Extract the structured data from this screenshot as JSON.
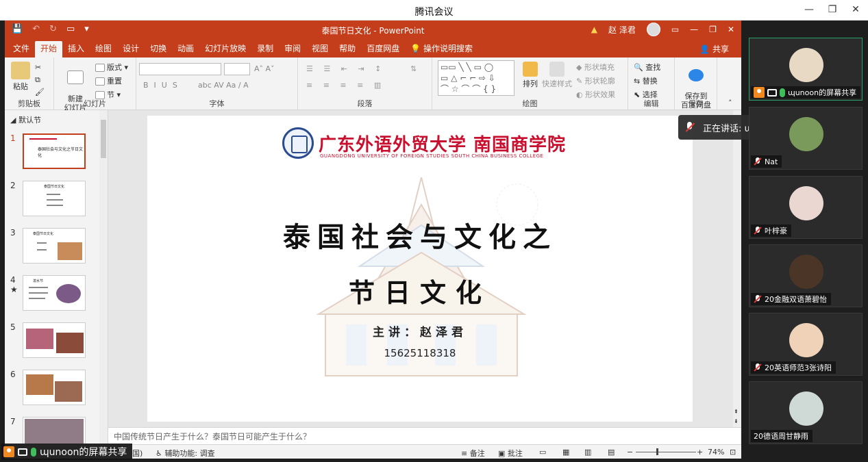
{
  "app": {
    "title": "腾讯会议"
  },
  "ppt": {
    "doc_title": "泰国节日文化 - PowerPoint",
    "user": "赵 泽君",
    "tabs": [
      "文件",
      "开始",
      "插入",
      "绘图",
      "设计",
      "切换",
      "动画",
      "幻灯片放映",
      "录制",
      "审阅",
      "视图",
      "帮助",
      "百度网盘"
    ],
    "active_tab": "开始",
    "tell_me": "操作说明搜索",
    "share": "共享",
    "ribbon": {
      "paste": "粘贴",
      "clipboard": "剪贴板",
      "new_slide": "新建\n幻灯片",
      "layout": "版式",
      "reset": "重置",
      "section": "节",
      "slides": "幻灯片",
      "font": "字体",
      "paragraph": "段落",
      "arrange": "排列",
      "quick_styles": "快速样式",
      "shape_fill": "形状填充",
      "shape_outline": "形状轮廓",
      "shape_effects": "形状效果",
      "drawing": "绘图",
      "find": "查找",
      "replace": "替换",
      "select": "选择",
      "editing": "编辑",
      "save_to_baidu": "保存到\n百度网盘",
      "save": "保存"
    },
    "thumbnails": {
      "section": "默认节",
      "numbers": [
        "1",
        "2",
        "3",
        "4",
        "5",
        "6",
        "7"
      ],
      "titles": [
        "泰国社会与文化之节日文化",
        "泰国节日文化",
        "泰国节日文化",
        "泼水节"
      ]
    },
    "slide": {
      "uni_name_cn": "广东外语外贸大学 南国商学院",
      "uni_name_en": "GUANGDONG UNIVERSITY OF FOREIGN STUDIES   SOUTH CHINA BUSINESS COLLEGE",
      "title_line1": "泰国社会与文化之",
      "title_line2": "节日文化",
      "presenter": "主讲：赵泽君",
      "phone": "15625118318"
    },
    "notes": "中国传统节日产生于什么？泰国节日可能产生于什么？",
    "status": {
      "accessibility": "辅助功能: 调查",
      "notes_btn": "备注",
      "comments_btn": "批注",
      "zoom": "74%",
      "partial_lang": "国)"
    }
  },
  "meeting": {
    "speaking_label": "正在讲话: ɰunoon;",
    "participants": [
      {
        "name": "ɰunoon的屏幕共享",
        "avatar_color": "#e8d9c4"
      },
      {
        "name": "Nat",
        "avatar_color": "#7a9a5b"
      },
      {
        "name": "叶梓豪",
        "avatar_color": "#ead7d2"
      },
      {
        "name": "20金融双语萧碧怡",
        "avatar_color": "#4a3526"
      },
      {
        "name": "20英语师范3张诗阳",
        "avatar_color": "#f0d2b8"
      },
      {
        "name": "20德语周甘静雨",
        "avatar_color": "#cfd9d6"
      }
    ],
    "sharer_label": "ɰunoon的屏幕共享"
  }
}
